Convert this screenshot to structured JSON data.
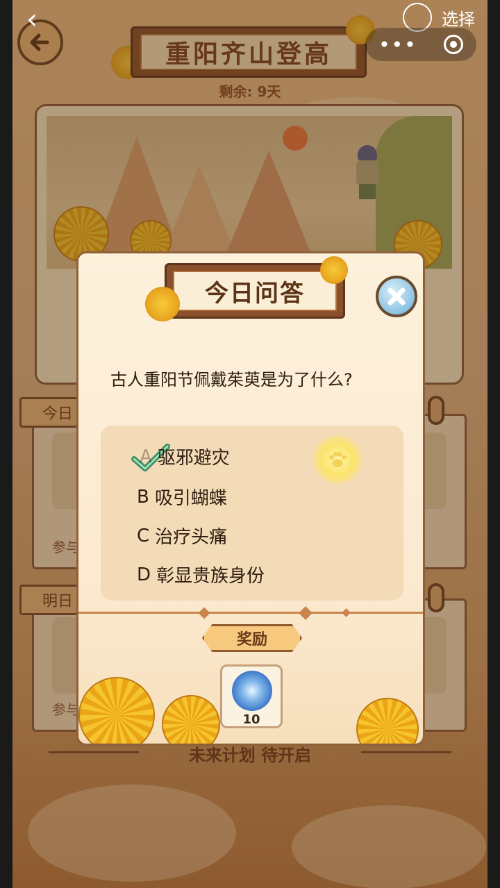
{
  "topbar": {
    "back_glyph": "‹",
    "select_label": "选择",
    "menu_dots": "•••"
  },
  "event": {
    "title": "重阳齐山登高",
    "remaining": "剩余: 9天"
  },
  "background_tabs": {
    "today_tab": "今日",
    "tomorrow_tab": "明日",
    "participate_1": "参与",
    "participate_2": "参与",
    "future": "未来计划 待开启"
  },
  "quiz": {
    "title": "今日问答",
    "question": "古人重阳节佩戴茱萸是为了什么?",
    "options": [
      {
        "letter": "A",
        "text": "驱邪避灾",
        "selected": true
      },
      {
        "letter": "B",
        "text": "吸引蝴蝶",
        "selected": false
      },
      {
        "letter": "C",
        "text": "治疗头痛",
        "selected": false
      },
      {
        "letter": "D",
        "text": "彰显贵族身份",
        "selected": false
      }
    ],
    "reward_label": "奖励",
    "reward_count": "10",
    "reward_icon": "blue-swirl-orb-icon"
  },
  "colors": {
    "accent_brown": "#8a4f2b",
    "modal_bg": "#fbe9cf",
    "check_green": "#4a9a6a"
  }
}
